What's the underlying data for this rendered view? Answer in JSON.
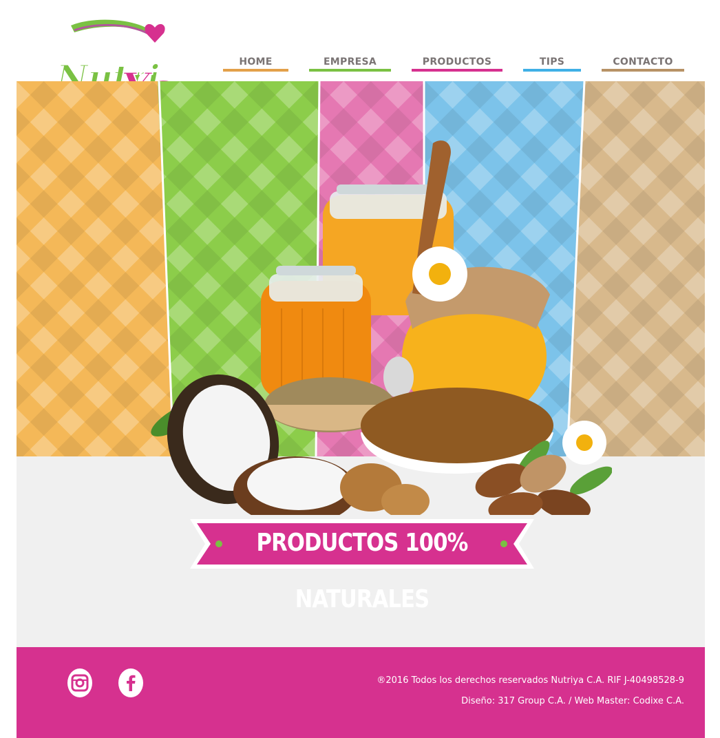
{
  "brand": {
    "logo_text": "NutriYa",
    "accent": "#d6318f",
    "green": "#7ac143"
  },
  "nav": {
    "items": [
      {
        "label": "HOME",
        "color": "#e3a04a"
      },
      {
        "label": "EMPRESA",
        "color": "#7ac143"
      },
      {
        "label": "PRODUCTOS",
        "color": "#d6318f"
      },
      {
        "label": "TIPS",
        "color": "#3fb0e6"
      },
      {
        "label": "CONTACTO",
        "color": "#b79266"
      }
    ]
  },
  "hero": {
    "banner_text": "PRODUCTOS 100% NATURALES",
    "stripe_colors": [
      "#f4b858",
      "#8ccd4a",
      "#e578b2",
      "#7cc3ea",
      "#d8b98c"
    ]
  },
  "footer": {
    "copyright": "®2016 Todos los derechos reservados Nutriya C.A. RIF J-40498528-9",
    "credits": "Diseño: 317 Group C.A. / Web Master: Codixe C.A.",
    "social": [
      "instagram-icon",
      "facebook-icon"
    ]
  }
}
